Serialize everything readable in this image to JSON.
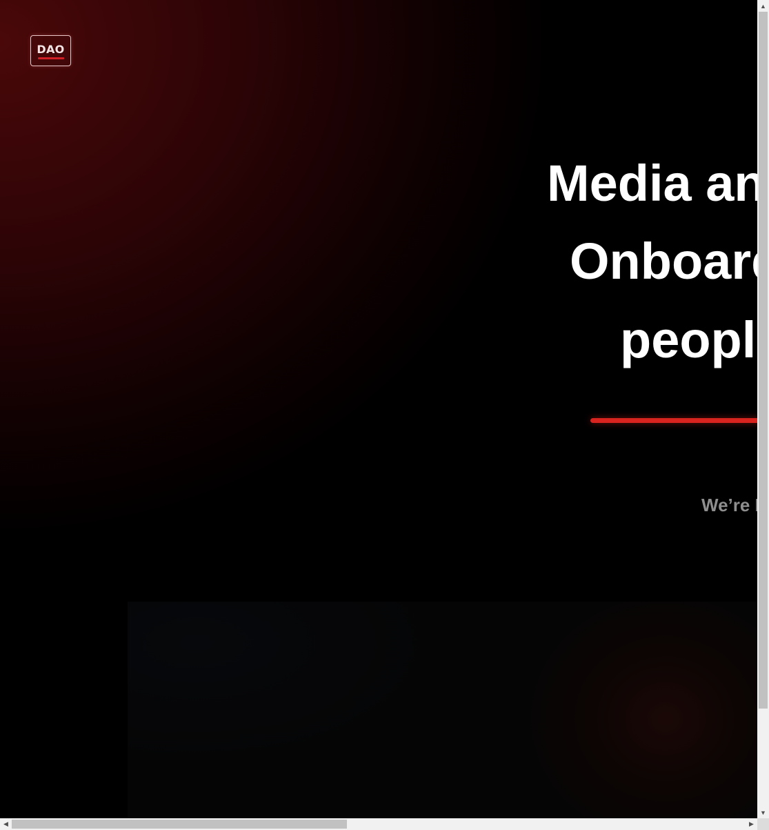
{
  "logo": {
    "text": "DAO"
  },
  "hero": {
    "headline_lines": [
      "Media an",
      "Onboard",
      "peopl"
    ],
    "subtext": "We’re I"
  },
  "colors": {
    "accent": "#d8231f",
    "background_glow": "#4a0809",
    "headline": "#ffffff",
    "subtext": "#8e8e8e"
  },
  "scrollbars": {
    "vertical": {
      "icons": [
        "arrow-up-icon",
        "arrow-down-icon"
      ]
    },
    "horizontal": {
      "icons": [
        "arrow-left-icon",
        "arrow-right-icon"
      ]
    }
  }
}
